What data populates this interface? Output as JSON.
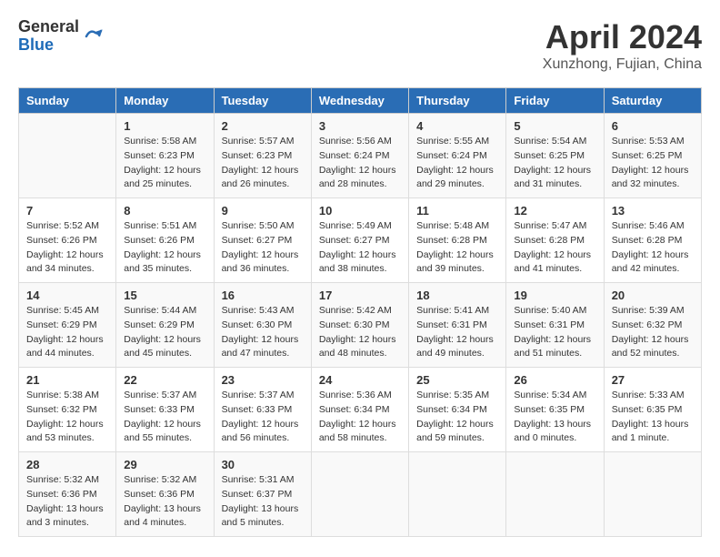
{
  "header": {
    "logo_general": "General",
    "logo_blue": "Blue",
    "title": "April 2024",
    "location": "Xunzhong, Fujian, China"
  },
  "calendar": {
    "columns": [
      "Sunday",
      "Monday",
      "Tuesday",
      "Wednesday",
      "Thursday",
      "Friday",
      "Saturday"
    ],
    "weeks": [
      [
        {
          "day": "",
          "info": ""
        },
        {
          "day": "1",
          "info": "Sunrise: 5:58 AM\nSunset: 6:23 PM\nDaylight: 12 hours\nand 25 minutes."
        },
        {
          "day": "2",
          "info": "Sunrise: 5:57 AM\nSunset: 6:23 PM\nDaylight: 12 hours\nand 26 minutes."
        },
        {
          "day": "3",
          "info": "Sunrise: 5:56 AM\nSunset: 6:24 PM\nDaylight: 12 hours\nand 28 minutes."
        },
        {
          "day": "4",
          "info": "Sunrise: 5:55 AM\nSunset: 6:24 PM\nDaylight: 12 hours\nand 29 minutes."
        },
        {
          "day": "5",
          "info": "Sunrise: 5:54 AM\nSunset: 6:25 PM\nDaylight: 12 hours\nand 31 minutes."
        },
        {
          "day": "6",
          "info": "Sunrise: 5:53 AM\nSunset: 6:25 PM\nDaylight: 12 hours\nand 32 minutes."
        }
      ],
      [
        {
          "day": "7",
          "info": "Sunrise: 5:52 AM\nSunset: 6:26 PM\nDaylight: 12 hours\nand 34 minutes."
        },
        {
          "day": "8",
          "info": "Sunrise: 5:51 AM\nSunset: 6:26 PM\nDaylight: 12 hours\nand 35 minutes."
        },
        {
          "day": "9",
          "info": "Sunrise: 5:50 AM\nSunset: 6:27 PM\nDaylight: 12 hours\nand 36 minutes."
        },
        {
          "day": "10",
          "info": "Sunrise: 5:49 AM\nSunset: 6:27 PM\nDaylight: 12 hours\nand 38 minutes."
        },
        {
          "day": "11",
          "info": "Sunrise: 5:48 AM\nSunset: 6:28 PM\nDaylight: 12 hours\nand 39 minutes."
        },
        {
          "day": "12",
          "info": "Sunrise: 5:47 AM\nSunset: 6:28 PM\nDaylight: 12 hours\nand 41 minutes."
        },
        {
          "day": "13",
          "info": "Sunrise: 5:46 AM\nSunset: 6:28 PM\nDaylight: 12 hours\nand 42 minutes."
        }
      ],
      [
        {
          "day": "14",
          "info": "Sunrise: 5:45 AM\nSunset: 6:29 PM\nDaylight: 12 hours\nand 44 minutes."
        },
        {
          "day": "15",
          "info": "Sunrise: 5:44 AM\nSunset: 6:29 PM\nDaylight: 12 hours\nand 45 minutes."
        },
        {
          "day": "16",
          "info": "Sunrise: 5:43 AM\nSunset: 6:30 PM\nDaylight: 12 hours\nand 47 minutes."
        },
        {
          "day": "17",
          "info": "Sunrise: 5:42 AM\nSunset: 6:30 PM\nDaylight: 12 hours\nand 48 minutes."
        },
        {
          "day": "18",
          "info": "Sunrise: 5:41 AM\nSunset: 6:31 PM\nDaylight: 12 hours\nand 49 minutes."
        },
        {
          "day": "19",
          "info": "Sunrise: 5:40 AM\nSunset: 6:31 PM\nDaylight: 12 hours\nand 51 minutes."
        },
        {
          "day": "20",
          "info": "Sunrise: 5:39 AM\nSunset: 6:32 PM\nDaylight: 12 hours\nand 52 minutes."
        }
      ],
      [
        {
          "day": "21",
          "info": "Sunrise: 5:38 AM\nSunset: 6:32 PM\nDaylight: 12 hours\nand 53 minutes."
        },
        {
          "day": "22",
          "info": "Sunrise: 5:37 AM\nSunset: 6:33 PM\nDaylight: 12 hours\nand 55 minutes."
        },
        {
          "day": "23",
          "info": "Sunrise: 5:37 AM\nSunset: 6:33 PM\nDaylight: 12 hours\nand 56 minutes."
        },
        {
          "day": "24",
          "info": "Sunrise: 5:36 AM\nSunset: 6:34 PM\nDaylight: 12 hours\nand 58 minutes."
        },
        {
          "day": "25",
          "info": "Sunrise: 5:35 AM\nSunset: 6:34 PM\nDaylight: 12 hours\nand 59 minutes."
        },
        {
          "day": "26",
          "info": "Sunrise: 5:34 AM\nSunset: 6:35 PM\nDaylight: 13 hours\nand 0 minutes."
        },
        {
          "day": "27",
          "info": "Sunrise: 5:33 AM\nSunset: 6:35 PM\nDaylight: 13 hours\nand 1 minute."
        }
      ],
      [
        {
          "day": "28",
          "info": "Sunrise: 5:32 AM\nSunset: 6:36 PM\nDaylight: 13 hours\nand 3 minutes."
        },
        {
          "day": "29",
          "info": "Sunrise: 5:32 AM\nSunset: 6:36 PM\nDaylight: 13 hours\nand 4 minutes."
        },
        {
          "day": "30",
          "info": "Sunrise: 5:31 AM\nSunset: 6:37 PM\nDaylight: 13 hours\nand 5 minutes."
        },
        {
          "day": "",
          "info": ""
        },
        {
          "day": "",
          "info": ""
        },
        {
          "day": "",
          "info": ""
        },
        {
          "day": "",
          "info": ""
        }
      ]
    ]
  }
}
